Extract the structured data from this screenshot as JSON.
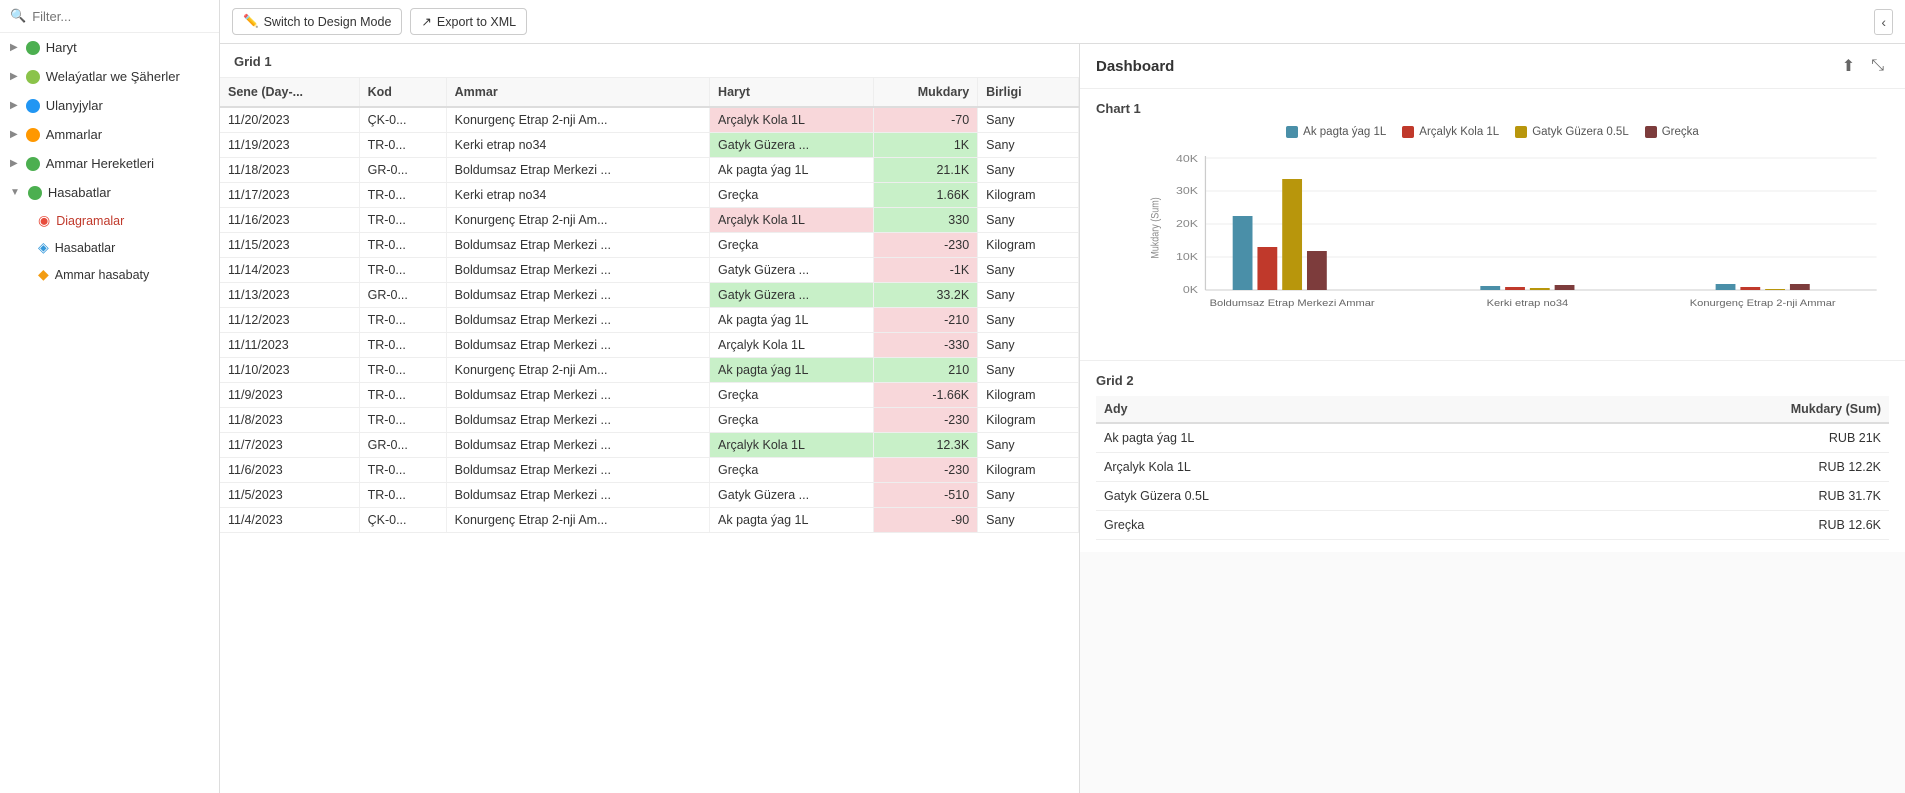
{
  "sidebar": {
    "search_placeholder": "Filter...",
    "items": [
      {
        "id": "haryt",
        "label": "Haryt",
        "icon": "folder-green",
        "expanded": false
      },
      {
        "id": "welayatlar",
        "label": "Welaýatlar we Şäherler",
        "icon": "folder-green-light",
        "expanded": false
      },
      {
        "id": "ulanyjylar",
        "label": "Ulanyjylar",
        "icon": "folder-blue",
        "expanded": false
      },
      {
        "id": "ammarlar",
        "label": "Ammarlar",
        "icon": "folder-orange",
        "expanded": false
      },
      {
        "id": "ammar-hereketleri",
        "label": "Ammar Hereketleri",
        "icon": "folder-green",
        "expanded": false
      },
      {
        "id": "hasabatlar",
        "label": "Hasabatlar",
        "icon": "folder-green",
        "expanded": true
      }
    ],
    "sub_items": [
      {
        "id": "diagramalar",
        "label": "Diagramalar",
        "icon": "circle-red",
        "active": true
      },
      {
        "id": "hasabatlar-sub",
        "label": "Hasabatlar",
        "icon": "circle-blue"
      },
      {
        "id": "ammar-hasabaty",
        "label": "Ammar hasabaty",
        "icon": "circle-yellow"
      }
    ]
  },
  "toolbar": {
    "switch_design_label": "Switch to Design Mode",
    "export_xml_label": "Export to XML",
    "collapse_icon": "‹",
    "expand_icon": "›"
  },
  "grid1": {
    "title": "Grid 1",
    "columns": [
      "Sene (Day-...",
      "Kod",
      "Ammar",
      "Haryt",
      "Mukdary",
      "Birligi"
    ],
    "rows": [
      {
        "date": "11/20/2023",
        "kod": "ÇK-0...",
        "ammar": "Konurgenç Etrap 2-nji Am...",
        "haryt": "Arçalyk Kola 1L",
        "mukdary": "-70",
        "birligi": "Sany",
        "haryt_color": "red",
        "mukd_color": "red"
      },
      {
        "date": "11/19/2023",
        "kod": "TR-0...",
        "ammar": "Kerki etrap no34",
        "haryt": "Gatyk Güzera ...",
        "mukdary": "1K",
        "birligi": "Sany",
        "haryt_color": "green",
        "mukd_color": "green"
      },
      {
        "date": "11/18/2023",
        "kod": "GR-0...",
        "ammar": "Boldumsaz Etrap Merkezi ...",
        "haryt": "Ak pagta ýag 1L",
        "mukdary": "21.1K",
        "birligi": "Sany",
        "haryt_color": "none",
        "mukd_color": "green"
      },
      {
        "date": "11/17/2023",
        "kod": "TR-0...",
        "ammar": "Kerki etrap no34",
        "haryt": "Greçka",
        "mukdary": "1.66K",
        "birligi": "Kilogram",
        "haryt_color": "none",
        "mukd_color": "green"
      },
      {
        "date": "11/16/2023",
        "kod": "TR-0...",
        "ammar": "Konurgenç Etrap 2-nji Am...",
        "haryt": "Arçalyk Kola 1L",
        "mukdary": "330",
        "birligi": "Sany",
        "haryt_color": "red",
        "mukd_color": "green"
      },
      {
        "date": "11/15/2023",
        "kod": "TR-0...",
        "ammar": "Boldumsaz Etrap Merkezi ...",
        "haryt": "Greçka",
        "mukdary": "-230",
        "birligi": "Kilogram",
        "haryt_color": "none",
        "mukd_color": "red"
      },
      {
        "date": "11/14/2023",
        "kod": "TR-0...",
        "ammar": "Boldumsaz Etrap Merkezi ...",
        "haryt": "Gatyk Güzera ...",
        "mukdary": "-1K",
        "birligi": "Sany",
        "haryt_color": "none",
        "mukd_color": "red"
      },
      {
        "date": "11/13/2023",
        "kod": "GR-0...",
        "ammar": "Boldumsaz Etrap Merkezi ...",
        "haryt": "Gatyk Güzera ...",
        "mukdary": "33.2K",
        "birligi": "Sany",
        "haryt_color": "green",
        "mukd_color": "green"
      },
      {
        "date": "11/12/2023",
        "kod": "TR-0...",
        "ammar": "Boldumsaz Etrap Merkezi ...",
        "haryt": "Ak pagta ýag 1L",
        "mukdary": "-210",
        "birligi": "Sany",
        "haryt_color": "none",
        "mukd_color": "red"
      },
      {
        "date": "11/11/2023",
        "kod": "TR-0...",
        "ammar": "Boldumsaz Etrap Merkezi ...",
        "haryt": "Arçalyk Kola 1L",
        "mukdary": "-330",
        "birligi": "Sany",
        "haryt_color": "none",
        "mukd_color": "red"
      },
      {
        "date": "11/10/2023",
        "kod": "TR-0...",
        "ammar": "Konurgenç Etrap 2-nji Am...",
        "haryt": "Ak pagta ýag 1L",
        "mukdary": "210",
        "birligi": "Sany",
        "haryt_color": "green",
        "mukd_color": "green"
      },
      {
        "date": "11/9/2023",
        "kod": "TR-0...",
        "ammar": "Boldumsaz Etrap Merkezi ...",
        "haryt": "Greçka",
        "mukdary": "-1.66K",
        "birligi": "Kilogram",
        "haryt_color": "none",
        "mukd_color": "red"
      },
      {
        "date": "11/8/2023",
        "kod": "TR-0...",
        "ammar": "Boldumsaz Etrap Merkezi ...",
        "haryt": "Greçka",
        "mukdary": "-230",
        "birligi": "Kilogram",
        "haryt_color": "none",
        "mukd_color": "red"
      },
      {
        "date": "11/7/2023",
        "kod": "GR-0...",
        "ammar": "Boldumsaz Etrap Merkezi ...",
        "haryt": "Arçalyk Kola 1L",
        "mukdary": "12.3K",
        "birligi": "Sany",
        "haryt_color": "green",
        "mukd_color": "green"
      },
      {
        "date": "11/6/2023",
        "kod": "TR-0...",
        "ammar": "Boldumsaz Etrap Merkezi ...",
        "haryt": "Greçka",
        "mukdary": "-230",
        "birligi": "Kilogram",
        "haryt_color": "none",
        "mukd_color": "red"
      },
      {
        "date": "11/5/2023",
        "kod": "TR-0...",
        "ammar": "Boldumsaz Etrap Merkezi ...",
        "haryt": "Gatyk Güzera ...",
        "mukdary": "-510",
        "birligi": "Sany",
        "haryt_color": "none",
        "mukd_color": "red"
      },
      {
        "date": "11/4/2023",
        "kod": "ÇK-0...",
        "ammar": "Konurgenç Etrap 2-nji Am...",
        "haryt": "Ak pagta ýag 1L",
        "mukdary": "-90",
        "birligi": "Sany",
        "haryt_color": "none",
        "mukd_color": "red"
      }
    ]
  },
  "dashboard": {
    "title": "Dashboard",
    "chart1": {
      "title": "Chart 1",
      "legend": [
        {
          "label": "Ak pagta ýag 1L",
          "color": "#4a8fa8"
        },
        {
          "label": "Arçalyk Kola 1L",
          "color": "#c0392b"
        },
        {
          "label": "Gatyk Güzera 0.5L",
          "color": "#b8960c"
        },
        {
          "label": "Greçka",
          "color": "#7d3c3c"
        }
      ],
      "x_labels": [
        "Boldumsaz Etrap Merkezi Ammar",
        "Kerki etrap no34",
        "Konurgenç Etrap 2-nji Ammar"
      ],
      "y_labels": [
        "0K",
        "10K",
        "20K",
        "30K",
        "40K"
      ],
      "bars": [
        {
          "group": "Boldumsaz Etrap Merkezi Ammar",
          "values": [
            {
              "color": "#4a8fa8",
              "height_pct": 52
            },
            {
              "color": "#c0392b",
              "height_pct": 30
            },
            {
              "color": "#b8960c",
              "height_pct": 78
            },
            {
              "color": "#7d3c3c",
              "height_pct": 28
            }
          ]
        },
        {
          "group": "Kerki etrap no34",
          "values": [
            {
              "color": "#4a8fa8",
              "height_pct": 2
            },
            {
              "color": "#c0392b",
              "height_pct": 0
            },
            {
              "color": "#b8960c",
              "height_pct": 0
            },
            {
              "color": "#7d3c3c",
              "height_pct": 4
            }
          ]
        },
        {
          "group": "Konurgenç Etrap 2-nji Ammar",
          "values": [
            {
              "color": "#4a8fa8",
              "height_pct": 3
            },
            {
              "color": "#c0392b",
              "height_pct": 1
            },
            {
              "color": "#b8960c",
              "height_pct": 0
            },
            {
              "color": "#7d3c3c",
              "height_pct": 4
            }
          ]
        }
      ]
    },
    "grid2": {
      "title": "Grid 2",
      "columns": [
        "Ady",
        "Mukdary (Sum)"
      ],
      "rows": [
        {
          "ady": "Ak pagta ýag 1L",
          "mukdary": "RUB 21K"
        },
        {
          "ady": "Arçalyk Kola 1L",
          "mukdary": "RUB 12.2K"
        },
        {
          "ady": "Gatyk Güzera 0.5L",
          "mukdary": "RUB 31.7K"
        },
        {
          "ady": "Greçka",
          "mukdary": "RUB 12.6K"
        }
      ]
    }
  }
}
